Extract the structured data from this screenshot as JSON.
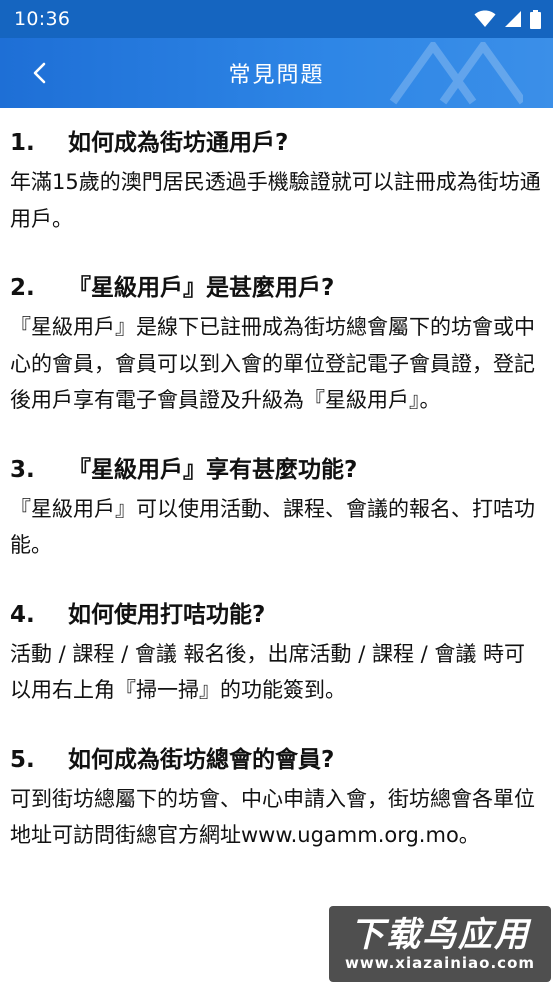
{
  "status_bar": {
    "time": "10:36",
    "icons": [
      "wifi-icon",
      "signal-icon",
      "battery-icon"
    ]
  },
  "app_bar": {
    "title": "常見問題",
    "back_icon": "chevron-left-icon",
    "background": "#2e86e6"
  },
  "faq": [
    {
      "num": "1.",
      "question": "如何成為街坊通用戶?",
      "answer": "年滿15歲的澳門居民透過手機驗證就可以註冊成為街坊通用戶。"
    },
    {
      "num": "2.",
      "question": "『星級用戶』是甚麼用戶?",
      "answer": "『星級用戶』是線下已註冊成為街坊總會屬下的坊會或中心的會員，會員可以到入會的單位登記電子會員證，登記後用戶享有電子會員證及升級為『星級用戶』。"
    },
    {
      "num": "3.",
      "question": "『星級用戶』享有甚麼功能?",
      "answer": "『星級用戶』可以使用活動、課程、會議的報名、打咭功能。"
    },
    {
      "num": "4.",
      "question": "如何使用打咭功能?",
      "answer": "活動 / 課程 / 會議 報名後，出席活動 / 課程 / 會議 時可以用右上角『掃一掃』的功能簽到。"
    },
    {
      "num": "5.",
      "question": "如何成為街坊總會的會員?",
      "answer": "可到街坊總屬下的坊會、中心申請入會，街坊總會各單位地址可訪問街總官方網址www.ugamm.org.mo。"
    }
  ],
  "watermark": {
    "main": "下载鸟应用",
    "sub": "www.xiazainiao.com"
  }
}
